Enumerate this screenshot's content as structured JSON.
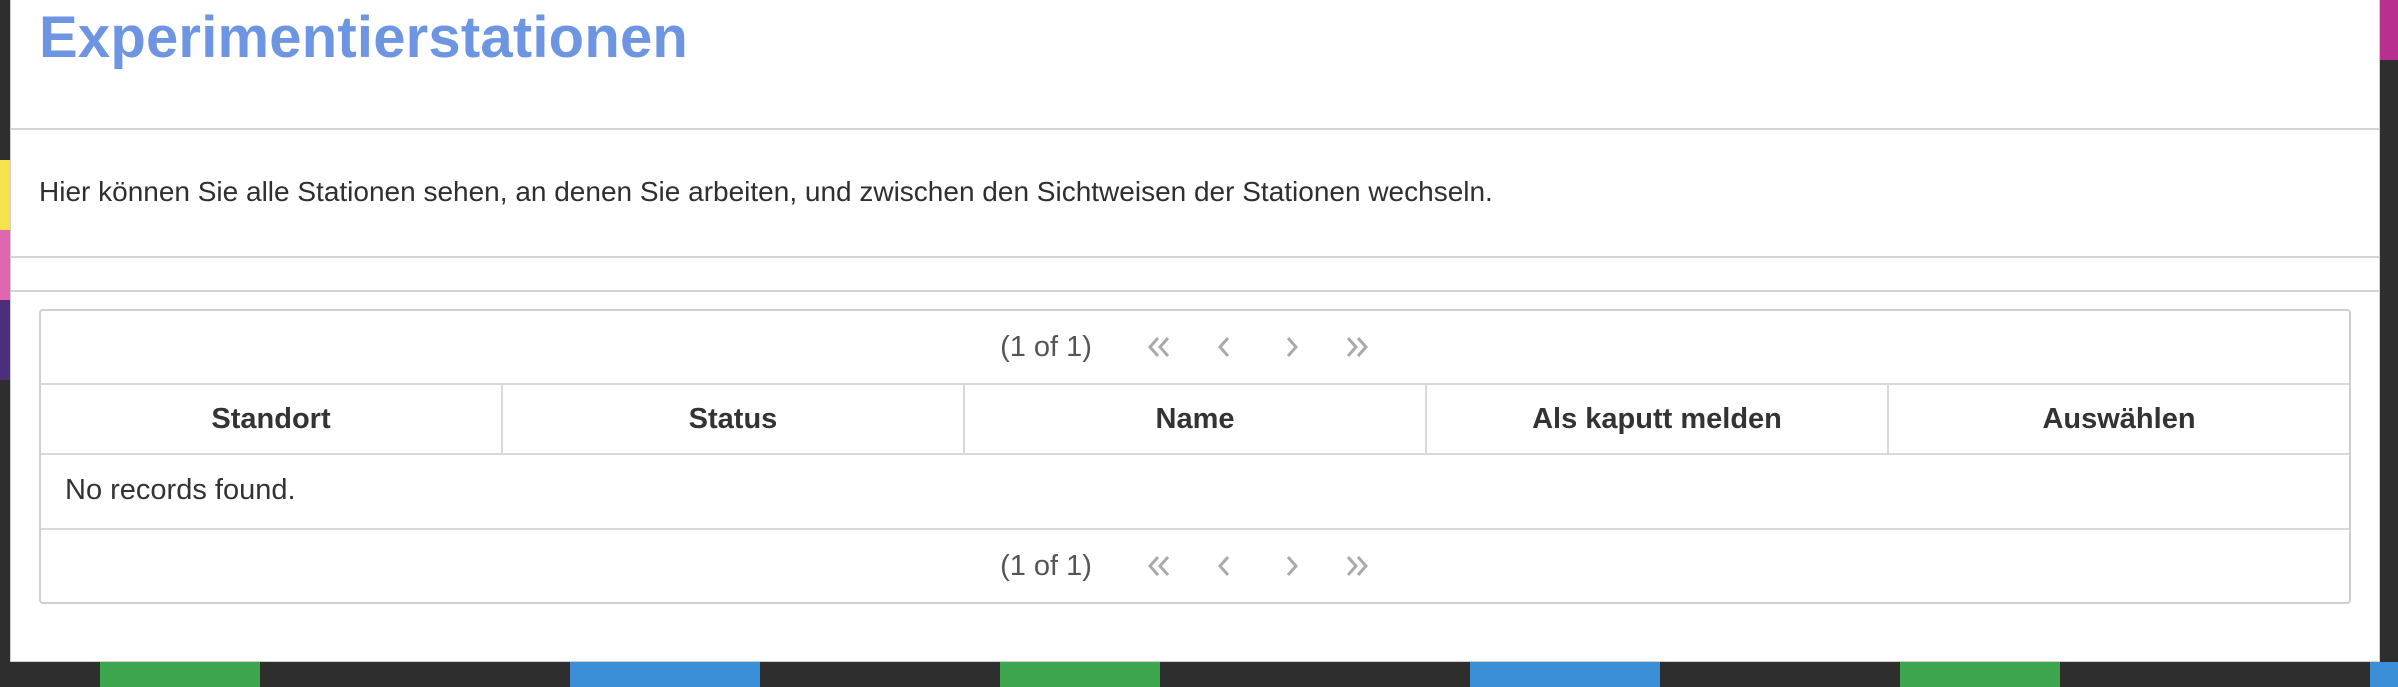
{
  "page": {
    "title": "Experimentierstationen",
    "description": "Hier können Sie alle Stationen sehen, an denen Sie arbeiten, und zwischen den Sichtweisen der Stationen wechseln."
  },
  "table": {
    "columns": [
      "Standort",
      "Status",
      "Name",
      "Als kaputt melden",
      "Auswählen"
    ],
    "empty_message": "No records found.",
    "rows": []
  },
  "paginator": {
    "info": "(1 of 1)",
    "first_icon": "double-chevron-left-icon",
    "prev_icon": "chevron-left-icon",
    "next_icon": "chevron-right-icon",
    "last_icon": "double-chevron-right-icon"
  },
  "colors": {
    "title": "#6e95e2",
    "panel_bg": "#ffffff",
    "page_bg": "#2e2e2e",
    "pager_icon": "#aaaaaa"
  }
}
